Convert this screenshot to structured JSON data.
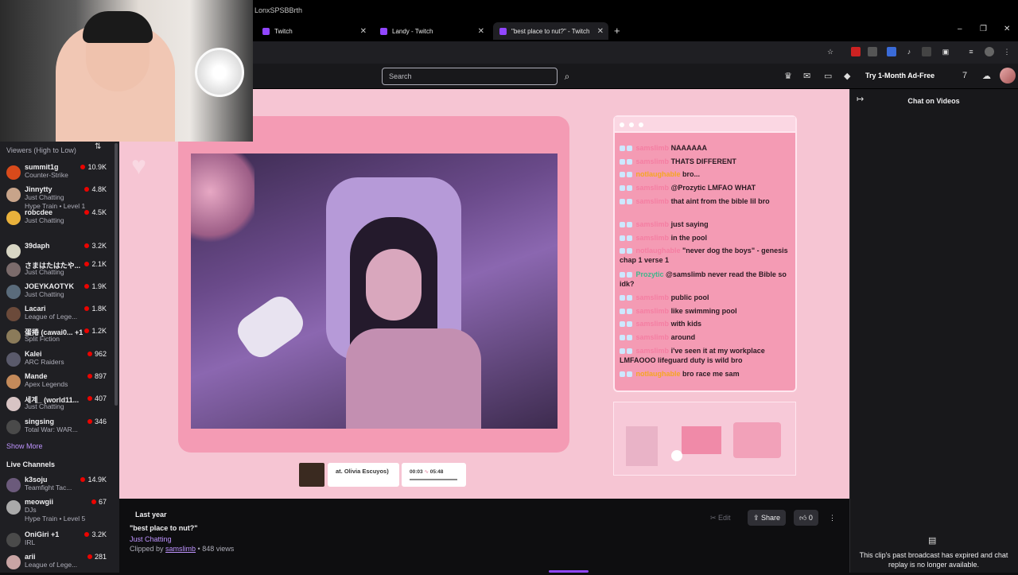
{
  "browser": {
    "tabs": [
      {
        "label": "Twitch"
      },
      {
        "label": "Landy - Twitch"
      },
      {
        "label": "\"best place to nut?\" - Twitch"
      }
    ],
    "new_tab": "+",
    "url": "LonxSPSBBrth",
    "win_min": "–",
    "win_max": "❐",
    "win_close": "✕"
  },
  "topnav": {
    "search_placeholder": "Search",
    "adfree": "Try 1-Month Ad-Free"
  },
  "sidebar": {
    "header": "Viewers (High to Low)",
    "followed": [
      {
        "name": "summit1g",
        "game": "Counter-Strike",
        "viewers": "10.9K",
        "color": "#d84a1b"
      },
      {
        "name": "Jinnytty",
        "game": "Just Chatting",
        "hype": "Hype Train • Level 1",
        "viewers": "4.8K",
        "color": "#c8a48a"
      },
      {
        "name": "robcdee",
        "game": "Just Chatting",
        "viewers": "4.5K",
        "color": "#e9b13b"
      },
      {
        "name": "39daph",
        "game": "",
        "viewers": "3.2K",
        "color": "#d8d6c4"
      },
      {
        "name": "さまはたはたや...",
        "game": "Just Chatting",
        "viewers": "2.1K",
        "color": "#7b6b6b"
      },
      {
        "name": "JOEYKAOTYK",
        "game": "Just Chatting",
        "viewers": "1.9K",
        "color": "#5a6b7b"
      },
      {
        "name": "Lacari",
        "game": "League of Lege...",
        "viewers": "1.8K",
        "color": "#6b4a3a"
      },
      {
        "name": "蛋捲 (cawai0... +1",
        "game": "Split Fiction",
        "viewers": "1.2K",
        "color": "#8b7b5a"
      },
      {
        "name": "Kalei",
        "game": "ARC Raiders",
        "viewers": "962",
        "color": "#5a5a6b"
      },
      {
        "name": "Mande",
        "game": "Apex Legends",
        "viewers": "897",
        "color": "#c48a5a"
      },
      {
        "name": "세계_ (world11...",
        "game": "Just Chatting",
        "viewers": "407",
        "color": "#d8c4c4"
      },
      {
        "name": "singsing",
        "game": "Total War: WAR...",
        "viewers": "346",
        "color": "#4a4a4a"
      }
    ],
    "show_more": "Show More",
    "live_header": "Live Channels",
    "live": [
      {
        "name": "k3soju",
        "game": "Teamfight Tac...",
        "viewers": "14.9K",
        "color": "#6b5a7b"
      },
      {
        "name": "meowgii",
        "game": "DJs",
        "hype": "Hype Train • Level 5",
        "viewers": "67",
        "color": "#aaa"
      },
      {
        "name": "OniGiri +1",
        "game": "IRL",
        "viewers": "3.2K",
        "color": "#4a4a4a"
      },
      {
        "name": "arii",
        "game": "League of Lege...",
        "viewers": "281",
        "color": "#c8a4a4"
      }
    ]
  },
  "overlay_chat": [
    {
      "user": "samslimb",
      "msg": "NAAAAAA",
      "ucls": "u"
    },
    {
      "user": "samslimb",
      "msg": "THATS DIFFERENT",
      "ucls": "u"
    },
    {
      "user": "notlaughable",
      "msg": "bro...",
      "ucls": "u2"
    },
    {
      "user": "samslimb",
      "msg": "@Prozytic LMFAO WHAT",
      "ucls": "u"
    },
    {
      "user": "samslimb",
      "msg": "that aint from the bible lil bro",
      "ucls": "u"
    },
    {
      "user": "samslimb",
      "msg": "just saying",
      "ucls": "u"
    },
    {
      "user": "samslimb",
      "msg": "in the pool",
      "ucls": "u"
    },
    {
      "user": "notlaughable",
      "msg": "\"never dog the boys\" - genesis chap 1 verse 1",
      "ucls": "u"
    },
    {
      "user": "Prozytic",
      "msg": "@samslimb never read the Bible so idk?",
      "ucls": "u3"
    },
    {
      "user": "samslimb",
      "msg": "public pool",
      "ucls": "u"
    },
    {
      "user": "samslimb",
      "msg": "like swimming pool",
      "ucls": "u"
    },
    {
      "user": "samslimb",
      "msg": "with kids",
      "ucls": "u"
    },
    {
      "user": "samslimb",
      "msg": "around",
      "ucls": "u"
    },
    {
      "user": "samslimb",
      "msg": "i've seen it at my workplace LMFAOOO lifeguard duty is wild bro",
      "ucls": "u"
    },
    {
      "user": "notlaughable",
      "msg": "bro race me sam",
      "ucls": "u2"
    }
  ],
  "music": {
    "title": "at. Olivia Escuyos)",
    "time_now": "00:03",
    "time_end": "05:48"
  },
  "clip": {
    "ago": "Last year",
    "title": "\"best place to nut?\"",
    "game": "Just Chatting",
    "clipped_by_prefix": "Clipped by ",
    "clipped_by": "samslimb",
    "views": " • 848 views",
    "edit": "Edit",
    "share": "Share",
    "likes": "0"
  },
  "rchat": {
    "title": "Chat on Videos",
    "message": "This clip's past broadcast has expired and chat replay is no longer available."
  }
}
